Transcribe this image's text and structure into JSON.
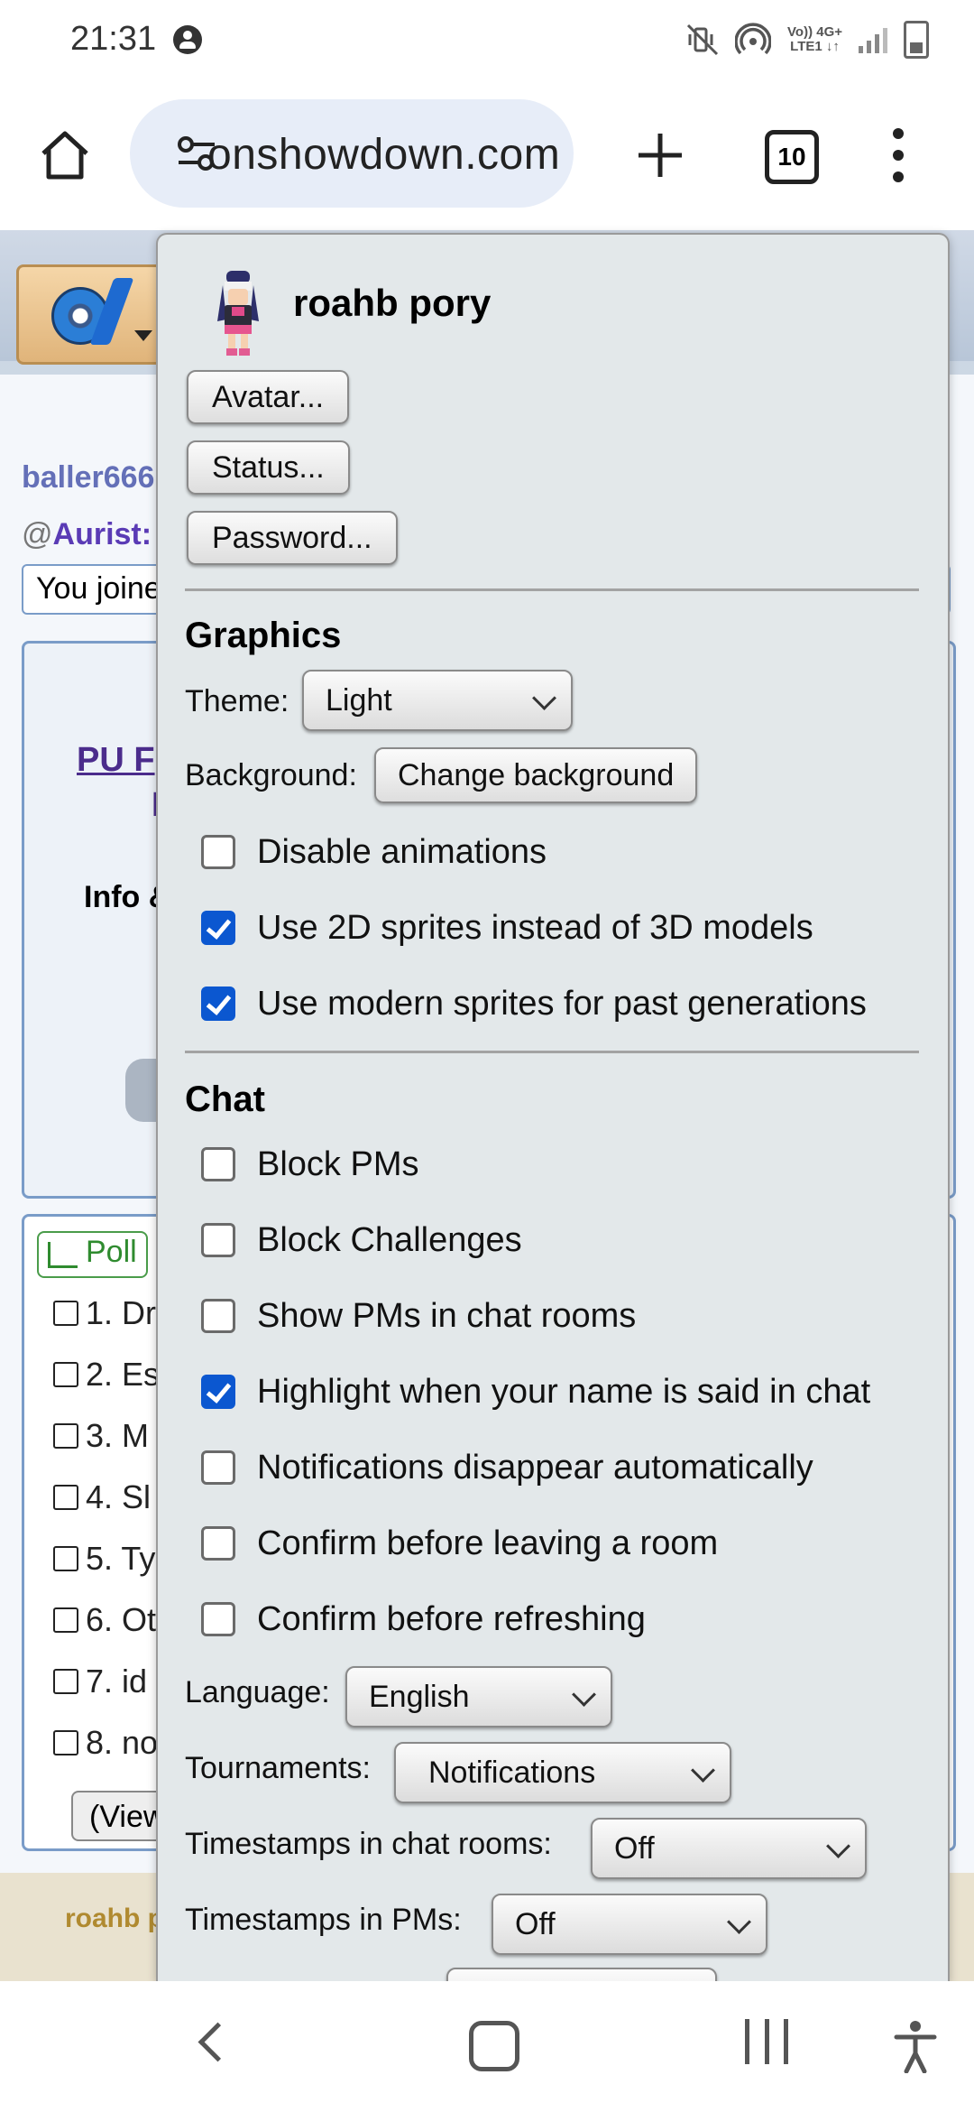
{
  "status_bar": {
    "time": "21:31",
    "net_top": "Vo)) 4G+",
    "net_bottom": "LTE1 ↓↑",
    "icons": [
      "notification-dot-icon",
      "mute-vibrate-icon",
      "hotspot-icon",
      "signal-icon",
      "battery-charging-icon"
    ]
  },
  "browser": {
    "url": "onshowdown.com",
    "tab_count": "10",
    "icons": [
      "home-icon",
      "site-info-icon",
      "new-tab-icon",
      "tab-switcher-icon",
      "more-menu-icon"
    ]
  },
  "background_page": {
    "count_fragment": "5",
    "line1_user": "baller666",
    "line2_prefix": "@",
    "line2_user": "Aurist:",
    "joined_text": "You joine",
    "card_link1": "PU F",
    "card_link2": "I",
    "card_info": "Info &",
    "poll_label": "Poll",
    "poll_options": [
      "1. Dr",
      "2. Es",
      "3. M",
      "4. Sl",
      "5. Ty",
      "6. Ot",
      "7. id",
      "8. no"
    ],
    "view_button": "(View",
    "footer_user": "roahb p"
  },
  "popup": {
    "username": "roahb pory",
    "buttons": {
      "avatar": "Avatar...",
      "status": "Status...",
      "password": "Password..."
    },
    "graphics": {
      "heading": "Graphics",
      "theme_label": "Theme:",
      "theme_value": "Light",
      "background_label": "Background:",
      "background_button": "Change background",
      "options": [
        {
          "label": "Disable animations",
          "checked": false
        },
        {
          "label": "Use 2D sprites instead of 3D models",
          "checked": true
        },
        {
          "label": "Use modern sprites for past generations",
          "checked": true
        }
      ]
    },
    "chat": {
      "heading": "Chat",
      "options": [
        {
          "label": "Block PMs",
          "checked": false
        },
        {
          "label": "Block Challenges",
          "checked": false
        },
        {
          "label": "Show PMs in chat rooms",
          "checked": false
        },
        {
          "label": "Highlight when your name is said in chat",
          "checked": true
        },
        {
          "label": "Notifications disappear automatically",
          "checked": false
        },
        {
          "label": "Confirm before leaving a room",
          "checked": false
        },
        {
          "label": "Confirm before refreshing",
          "checked": false
        }
      ],
      "language_label": "Language:",
      "language_value": "English",
      "tournaments_label": "Tournaments:",
      "tournaments_value": "Notifications",
      "timestamps_rooms_label": "Timestamps in chat rooms:",
      "timestamps_rooms_value": "Off",
      "timestamps_pms_label": "Timestamps in PMs:",
      "timestamps_pms_value": "Off"
    }
  },
  "nav_bar": {
    "icons": [
      "back-icon",
      "home-circle-icon",
      "recents-icon",
      "accessibility-icon"
    ]
  },
  "colors": {
    "checkbox_checked": "#0b57d0",
    "popup_bg": "#e3e8ea",
    "url_bar_bg": "#e7edf8"
  }
}
